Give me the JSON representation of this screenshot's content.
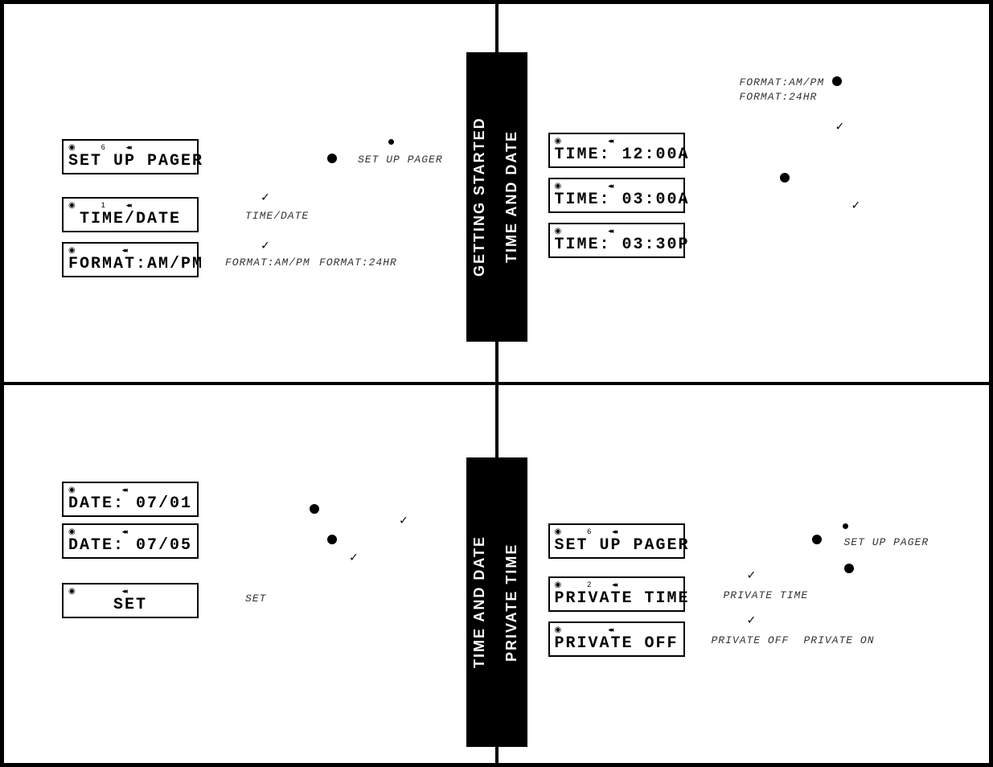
{
  "tabs": {
    "q1": "GETTING STARTED",
    "q2": "TIME AND DATE",
    "q3": "TIME AND DATE",
    "q4": "PRIVATE TIME"
  },
  "q1": {
    "lcd1": "SET UP PAGER",
    "lcd1_num": "6",
    "lcd2": " TIME/DATE",
    "lcd2_num": "1",
    "lcd3": "FORMAT:AM/PM",
    "side_setup": "SET UP PAGER",
    "side_timedate": "TIME/DATE",
    "side_format_ampm": "FORMAT:AM/PM",
    "side_format_24": "FORMAT:24HR"
  },
  "q2": {
    "lcd1": "TIME: 12:00A",
    "lcd2": "TIME: 03:00A",
    "lcd3": "TIME: 03:30P",
    "side_format_ampm": "FORMAT:AM/PM",
    "side_format_24": "FORMAT:24HR"
  },
  "q3": {
    "lcd1": "DATE: 07/01",
    "lcd2": "DATE: 07/05",
    "lcd3": "    SET",
    "side_set": "SET"
  },
  "q4": {
    "lcd1": "SET UP PAGER",
    "lcd1_num": "6",
    "lcd2": "PRIVATE TIME",
    "lcd2_num": "2",
    "lcd3": "PRIVATE OFF",
    "side_setup": "SET UP PAGER",
    "side_private_time": "PRIVATE TIME",
    "side_private_off": "PRIVATE OFF",
    "side_private_on": "PRIVATE ON"
  }
}
